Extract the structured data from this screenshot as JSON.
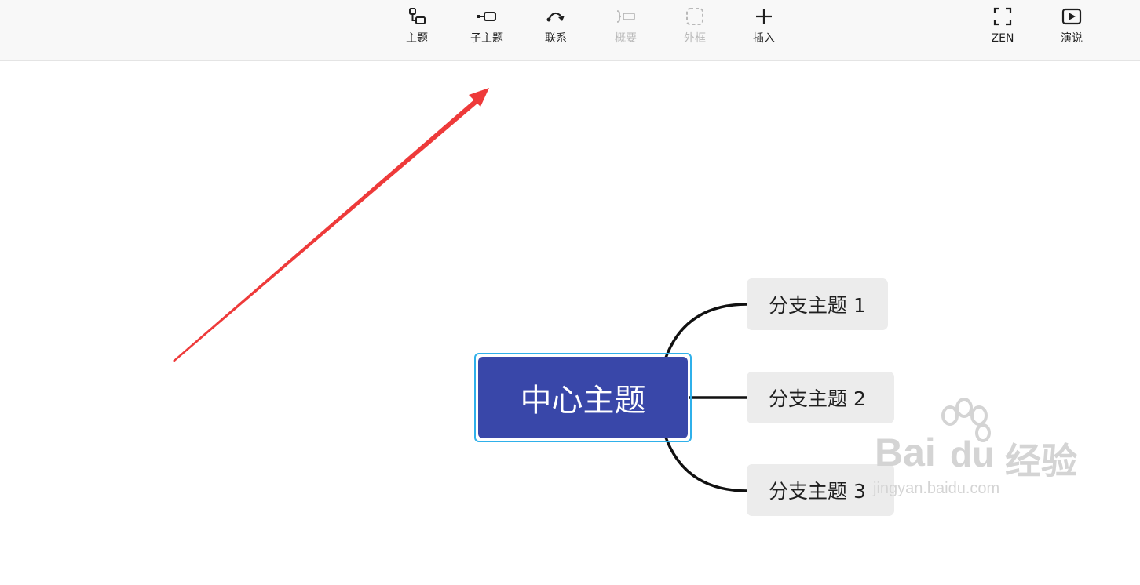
{
  "toolbar": {
    "items": [
      {
        "label": "主题",
        "icon": "topic-icon",
        "enabled": true
      },
      {
        "label": "子主题",
        "icon": "subtopic-icon",
        "enabled": true
      },
      {
        "label": "联系",
        "icon": "relationship-icon",
        "enabled": true
      },
      {
        "label": "概要",
        "icon": "summary-icon",
        "enabled": false
      },
      {
        "label": "外框",
        "icon": "boundary-icon",
        "enabled": false
      },
      {
        "label": "插入",
        "icon": "plus-icon",
        "enabled": true
      }
    ],
    "right_items": [
      {
        "label": "ZEN",
        "icon": "fullscreen-icon"
      },
      {
        "label": "演说",
        "icon": "play-icon"
      }
    ]
  },
  "mindmap": {
    "central_topic": "中心主题",
    "central_color": "#3947a9",
    "selection_color": "#2fb0ea",
    "branches": [
      {
        "label": "分支主题 1"
      },
      {
        "label": "分支主题 2"
      },
      {
        "label": "分支主题 3"
      }
    ]
  },
  "annotation": {
    "arrow_color": "#ee3a3a"
  },
  "watermark": {
    "brand_latin_1": "Bai",
    "brand_latin_2": "du",
    "brand_cn": "经验",
    "url": "jingyan.baidu.com"
  }
}
